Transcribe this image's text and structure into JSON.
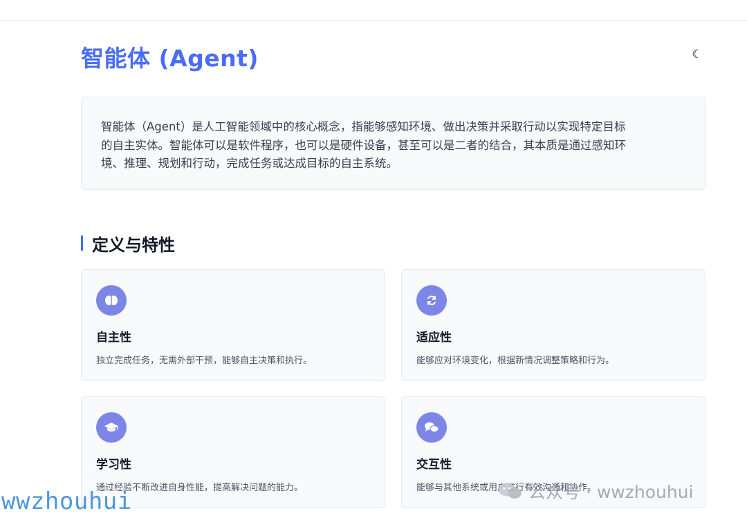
{
  "header": {
    "title": "智能体 (Agent)",
    "theme_toggle_icon": "moon-icon"
  },
  "intro": {
    "lines": [
      "智能体（Agent）是人工智能领域中的核心概念，指能够感知环境、做出决策并采取行动以实现特定目标",
      "的自主实体。智能体可以是软件程序，也可以是硬件设备，甚至可以是二者的结合，其本质是通过感知环",
      "境、推理、规划和行动，完成任务或达成目标的自主系统。"
    ]
  },
  "section": {
    "title": "定义与特性"
  },
  "cards": [
    {
      "icon": "brain-icon",
      "title": "自主性",
      "desc": "独立完成任务，无需外部干预，能够自主决策和执行。"
    },
    {
      "icon": "sync-icon",
      "title": "适应性",
      "desc": "能够应对环境变化，根据新情况调整策略和行为。"
    },
    {
      "icon": "graduation-cap-icon",
      "title": "学习性",
      "desc": "通过经验不断改进自身性能，提高解决问题的能力。"
    },
    {
      "icon": "chat-bubbles-icon",
      "title": "交互性",
      "desc": "能够与其他系统或用户进行有效沟通和协作。"
    }
  ],
  "watermark": {
    "left_text": "wwzhouhui",
    "right_text": "公众号 · wwzhouhui"
  },
  "colors": {
    "accent": "#4a6cf7",
    "icon_bg": "#7c86e6",
    "card_bg": "#f8f9fb",
    "watermark_blue": "#2f86d6"
  }
}
